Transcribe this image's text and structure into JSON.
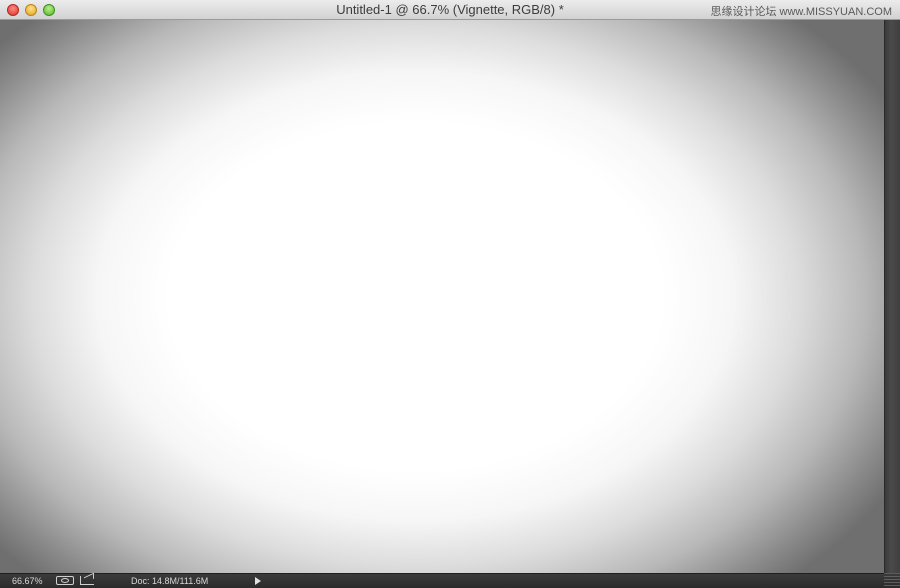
{
  "window": {
    "title": "Untitled-1 @ 66.7% (Vignette, RGB/8) *",
    "watermark": "思缘设计论坛 www.MISSYUAN.COM"
  },
  "titlebar": {
    "controls": [
      "close-icon",
      "minimize-icon",
      "zoom-icon"
    ]
  },
  "statusbar": {
    "zoom": "66.67%",
    "doc_size": "Doc: 14.8M/111.6M",
    "icons": [
      "efficiency-gauge-icon",
      "share-icon",
      "menu-arrow-icon"
    ]
  },
  "colors": {
    "canvas_center": "#ffffff",
    "canvas_edge": "#6f6f6f",
    "statusbar_bg": "#2f2f2f"
  }
}
